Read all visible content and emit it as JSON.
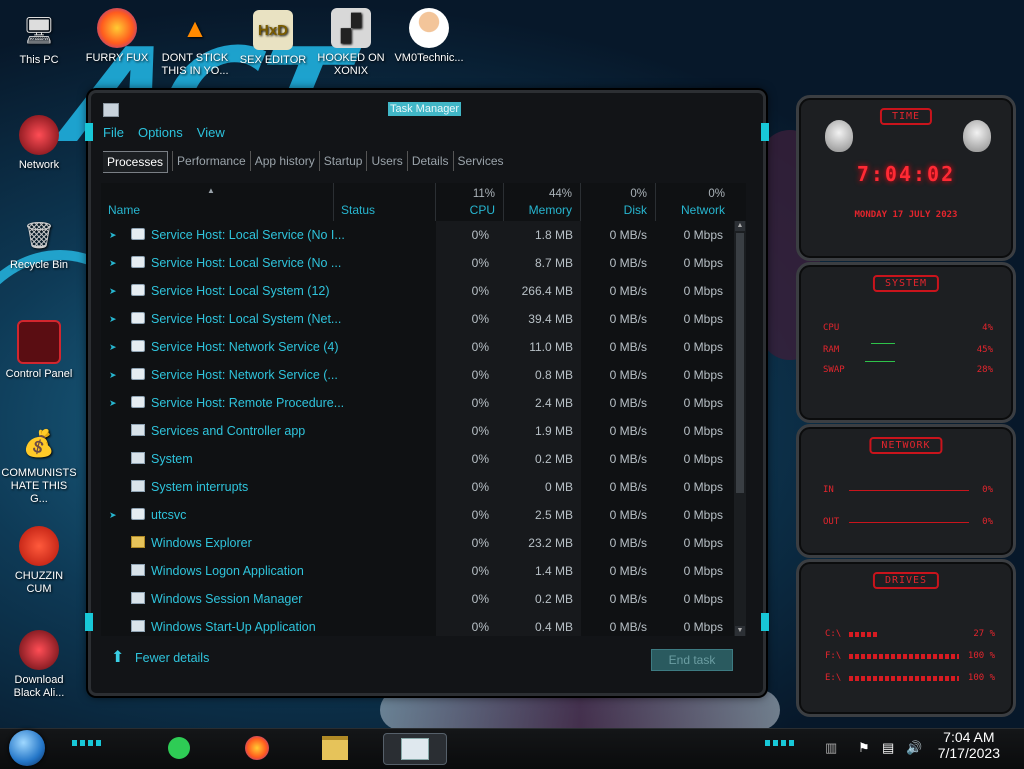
{
  "desktop": {
    "icons": [
      {
        "label": "This PC",
        "glyph": "computer-icon"
      },
      {
        "label": "FURRY FUX",
        "glyph": "firefox-icon"
      },
      {
        "label": "DONT STICK THIS IN YO...",
        "glyph": "vlc-icon"
      },
      {
        "label": "SEX EDITOR",
        "glyph": "hex-editor-icon"
      },
      {
        "label": "HOOKED ON XONIX",
        "glyph": "game-icon"
      },
      {
        "label": "VM0Technic...",
        "glyph": "doctor-icon"
      },
      {
        "label": "Network",
        "glyph": "network-icon"
      },
      {
        "label": "Recycle Bin",
        "glyph": "recycle-bin-icon"
      },
      {
        "label": "Control Panel",
        "glyph": "control-panel-icon"
      },
      {
        "label": "COMMUNISTS HATE THIS G...",
        "glyph": "money-bag-icon"
      },
      {
        "label": "CHUZZIN CUM",
        "glyph": "chuzzle-icon"
      },
      {
        "label": "Download Black Ali...",
        "glyph": "alien-download-icon"
      }
    ]
  },
  "task_manager": {
    "title": "Task Manager",
    "menu": [
      "File",
      "Options",
      "View"
    ],
    "tabs": [
      "Processes",
      "Performance",
      "App history",
      "Startup",
      "Users",
      "Details",
      "Services"
    ],
    "active_tab": "Processes",
    "columns": {
      "name": "Name",
      "status": "Status",
      "cpu": {
        "label": "CPU",
        "pct": "11%"
      },
      "memory": {
        "label": "Memory",
        "pct": "44%"
      },
      "disk": {
        "label": "Disk",
        "pct": "0%"
      },
      "network": {
        "label": "Network",
        "pct": "0%"
      }
    },
    "rows": [
      {
        "name": "Service Host: Local Service (No I...",
        "expand": true,
        "icon": "gear",
        "cpu": "0%",
        "memory": "1.8 MB",
        "disk": "0 MB/s",
        "network": "0 Mbps"
      },
      {
        "name": "Service Host: Local Service (No ...",
        "expand": true,
        "icon": "gear",
        "cpu": "0%",
        "memory": "8.7 MB",
        "disk": "0 MB/s",
        "network": "0 Mbps"
      },
      {
        "name": "Service Host: Local System (12)",
        "expand": true,
        "icon": "gear",
        "cpu": "0%",
        "memory": "266.4 MB",
        "disk": "0 MB/s",
        "network": "0 Mbps"
      },
      {
        "name": "Service Host: Local System (Net...",
        "expand": true,
        "icon": "gear",
        "cpu": "0%",
        "memory": "39.4 MB",
        "disk": "0 MB/s",
        "network": "0 Mbps"
      },
      {
        "name": "Service Host: Network Service (4)",
        "expand": true,
        "icon": "gear",
        "cpu": "0%",
        "memory": "11.0 MB",
        "disk": "0 MB/s",
        "network": "0 Mbps"
      },
      {
        "name": "Service Host: Network Service (...",
        "expand": true,
        "icon": "gear",
        "cpu": "0%",
        "memory": "0.8 MB",
        "disk": "0 MB/s",
        "network": "0 Mbps"
      },
      {
        "name": "Service Host: Remote Procedure...",
        "expand": true,
        "icon": "gear",
        "cpu": "0%",
        "memory": "2.4 MB",
        "disk": "0 MB/s",
        "network": "0 Mbps"
      },
      {
        "name": "Services and Controller app",
        "expand": false,
        "icon": "window",
        "cpu": "0%",
        "memory": "1.9 MB",
        "disk": "0 MB/s",
        "network": "0 Mbps"
      },
      {
        "name": "System",
        "expand": false,
        "icon": "window",
        "cpu": "0%",
        "memory": "0.2 MB",
        "disk": "0 MB/s",
        "network": "0 Mbps"
      },
      {
        "name": "System interrupts",
        "expand": false,
        "icon": "window",
        "cpu": "0%",
        "memory": "0 MB",
        "disk": "0 MB/s",
        "network": "0 Mbps"
      },
      {
        "name": "utcsvc",
        "expand": true,
        "icon": "gear",
        "cpu": "0%",
        "memory": "2.5 MB",
        "disk": "0 MB/s",
        "network": "0 Mbps"
      },
      {
        "name": "Windows Explorer",
        "expand": false,
        "icon": "folder",
        "cpu": "0%",
        "memory": "23.2 MB",
        "disk": "0 MB/s",
        "network": "0 Mbps"
      },
      {
        "name": "Windows Logon Application",
        "expand": false,
        "icon": "window",
        "cpu": "0%",
        "memory": "1.4 MB",
        "disk": "0 MB/s",
        "network": "0 Mbps"
      },
      {
        "name": "Windows Session Manager",
        "expand": false,
        "icon": "window",
        "cpu": "0%",
        "memory": "0.2 MB",
        "disk": "0 MB/s",
        "network": "0 Mbps"
      },
      {
        "name": "Windows Start-Up Application",
        "expand": false,
        "icon": "window",
        "cpu": "0%",
        "memory": "0.4 MB",
        "disk": "0 MB/s",
        "network": "0 Mbps"
      }
    ],
    "fewer_details": "Fewer details",
    "end_task": "End task"
  },
  "gadgets": {
    "time": {
      "title": "TIME",
      "clock": "7:04:02",
      "date": "MONDAY 17 JULY 2023"
    },
    "system": {
      "title": "SYSTEM",
      "cpu_label": "CPU",
      "cpu_value": "4%",
      "ram_label": "RAM",
      "ram_value": "45%",
      "swap_label": "SWAP",
      "swap_value": "28%"
    },
    "network": {
      "title": "NETWORK",
      "in_label": "IN",
      "in_value": "0%",
      "out_label": "OUT",
      "out_value": "0%"
    },
    "drives": {
      "title": "DRIVES",
      "items": [
        {
          "label": "C:\\",
          "value": "27 %",
          "fill": 0.27
        },
        {
          "label": "F:\\",
          "value": "100 %",
          "fill": 1.0
        },
        {
          "label": "E:\\",
          "value": "100 %",
          "fill": 1.0
        }
      ]
    }
  },
  "taskbar": {
    "time": "7:04 AM",
    "date": "7/17/2023",
    "pinned": [
      "chat-app-icon",
      "firefox-icon",
      "file-explorer-icon",
      "task-manager-icon"
    ]
  },
  "colors": {
    "accent": "#2fc4dc",
    "gadget_red": "#e3252d",
    "window_bg": "#121417"
  }
}
